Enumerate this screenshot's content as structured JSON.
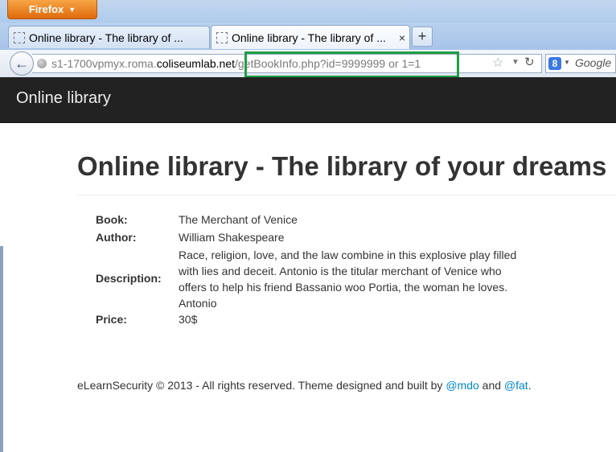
{
  "browser": {
    "menu_button": "Firefox",
    "tabs": [
      {
        "title": "Online library - The library of ..."
      },
      {
        "title": "Online library - The library of ..."
      }
    ],
    "new_tab": "+",
    "close_glyph": "×",
    "url": {
      "prefix": "s1-1700vpmyx.roma.",
      "domain": "coliseumlab.net",
      "path": "/getBookInfo.php?id=9999999 or 1=1"
    },
    "search_engine": "Google",
    "highlight_color": "#1f9e44"
  },
  "site": {
    "brand": "Online library",
    "page_title": "Online library - The library of your dreams",
    "book_details": [
      {
        "label": "Book:",
        "value": "The Merchant of Venice"
      },
      {
        "label": "Author:",
        "value": "William Shakespeare"
      },
      {
        "label": "Description:",
        "value": "Race, religion, love, and the law combine in this explosive play filled with lies and deceit. Antonio is the titular merchant of Venice who offers to help his friend Bassanio woo Portia, the woman he loves. Antonio"
      },
      {
        "label": "Price:",
        "value": "30$"
      }
    ],
    "footer": {
      "text": "eLearnSecurity © 2013 - All rights reserved. Theme designed and built by ",
      "link1": "@mdo",
      "and": " and ",
      "link2": "@fat",
      "end": "."
    }
  },
  "colors": {
    "navbar": "#222222",
    "link": "#0088cc",
    "firefox_orange": "#e06a0c"
  }
}
